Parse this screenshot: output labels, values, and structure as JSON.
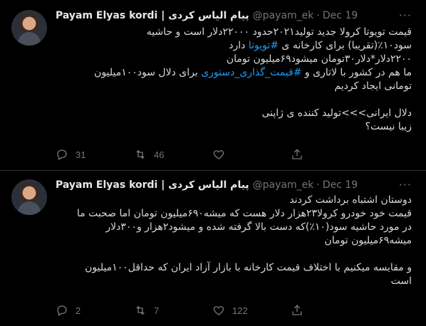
{
  "tweets": [
    {
      "author_name": "Payam Elyas kordi | پیام الیاس کردی",
      "handle": "@payam_ek",
      "dot": "·",
      "date": "Dec 19",
      "lines": [
        {
          "parts": [
            "قیمت تویوتا کرولا جدید تولید۲۰۲۱حدود ۲۲۰۰۰دلار است و حاشیه"
          ]
        },
        {
          "parts": [
            "سود۱۰٪(تقریبا) برای کارخانه ی ",
            "#تویوتا",
            " دارد"
          ]
        },
        {
          "parts": [
            "۲۲۰۰دلار*دلار۳۰تومان میشود۶۹میلیون تومان"
          ]
        },
        {
          "parts": [
            "ما هم در کشور با لاتاری و ",
            "#قیمت_گذاری_دستوری",
            " برای دلال سود۱۰۰میلیون"
          ]
        },
        {
          "parts": [
            "تومانی ایجاد کردیم"
          ]
        },
        {
          "parts": [
            ""
          ]
        },
        {
          "parts": [
            "دلال ایرانی>>>تولید کننده ی ژاپنی"
          ]
        },
        {
          "parts": [
            "زیبا نیست؟"
          ]
        }
      ],
      "replies": "31",
      "retweets": "46",
      "likes": ""
    },
    {
      "author_name": "Payam Elyas kordi | پیام الیاس کردی",
      "handle": "@payam_ek",
      "dot": "·",
      "date": "Dec 19",
      "lines": [
        {
          "parts": [
            "دوستان اشتباه برداشت کردند"
          ]
        },
        {
          "parts": [
            "قیمت خود خودرو کرولا۲۳هزار دلار هست که میشه۶۹۰میلیون تومان اما صحبت ما"
          ]
        },
        {
          "parts": [
            "در مورد حاشیه سود(۱۰٪)که دست بالا گرفته شده و میشود۲هزار و۳۰۰دلار"
          ]
        },
        {
          "parts": [
            "میشه۶۹میلیون تومان"
          ]
        },
        {
          "parts": [
            ""
          ]
        },
        {
          "parts": [
            "و مقایسه میکنیم با اختلاف قیمت کارخانه با بازار آزاد ایران که حداقل۱۰۰میلیون"
          ]
        },
        {
          "parts": [
            "است"
          ]
        }
      ],
      "replies": "2",
      "retweets": "7",
      "likes": "122"
    }
  ]
}
